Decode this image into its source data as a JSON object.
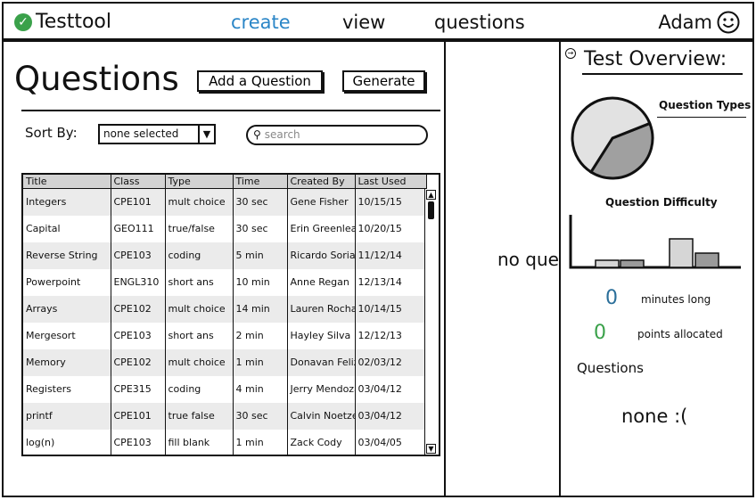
{
  "app": {
    "name": "Testtool"
  },
  "nav": {
    "create": "create",
    "view": "view",
    "questions": "questions"
  },
  "user": {
    "name": "Adam"
  },
  "colors": {
    "accent": "#2b86c7",
    "brand_green": "#3aa14a",
    "stat_green": "#3aa14a",
    "stat_blue": "#2b6f9a"
  },
  "questions_page": {
    "title": "Questions",
    "add_button": "Add a Question",
    "generate_button": "Generate",
    "sort_label": "Sort By:",
    "sort_value": "none selected",
    "search_placeholder": "search",
    "table": {
      "headers": [
        "Title",
        "Class",
        "Type",
        "Time",
        "Created By",
        "Last Used"
      ],
      "rows": [
        [
          "Integers",
          "CPE101",
          "mult choice",
          "30 sec",
          "Gene Fisher",
          "10/15/15"
        ],
        [
          "Capital",
          "GEO111",
          "true/false",
          "30 sec",
          "Erin Greenleaf",
          "10/20/15"
        ],
        [
          "Reverse String",
          "CPE103",
          "coding",
          "5 min",
          "Ricardo Soriano",
          "11/12/14"
        ],
        [
          "Powerpoint",
          "ENGL310",
          "short ans",
          "10 min",
          "Anne Regan",
          "12/13/14"
        ],
        [
          "Arrays",
          "CPE102",
          "mult choice",
          "14 min",
          "Lauren Rocha",
          "10/14/15"
        ],
        [
          "Mergesort",
          "CPE103",
          "short ans",
          "2 min",
          "Hayley Silva",
          "12/12/13"
        ],
        [
          "Memory",
          "CPE102",
          "mult choice",
          "1 min",
          "Donavan Feliz",
          "02/03/12"
        ],
        [
          "Registers",
          "CPE315",
          "coding",
          "4 min",
          "Jerry Mendoza",
          "03/04/12"
        ],
        [
          "printf",
          "CPE101",
          "true false",
          "30 sec",
          "Calvin Noetzel",
          "03/04/12"
        ],
        [
          "log(n)",
          "CPE103",
          "fill blank",
          "1 min",
          "Zack Cody",
          "03/04/05"
        ]
      ]
    }
  },
  "selected_panel": {
    "empty_message": "no questions"
  },
  "overview": {
    "title": "Test Overview:",
    "question_types_label": "Question Types",
    "question_difficulty_label": "Question Difficulty",
    "minutes_value": "0",
    "minutes_label": "minutes long",
    "points_value": "0",
    "points_label": "points allocated",
    "questions_label": "Questions",
    "questions_value": "none :("
  },
  "chart_data": [
    {
      "type": "pie",
      "title": "Question Types",
      "slices": [
        {
          "value": 0.4,
          "color": "#a0a0a0"
        },
        {
          "value": 0.6,
          "color": "#e2e2e2"
        }
      ]
    },
    {
      "type": "bar",
      "title": "Question Difficulty",
      "values": [
        1,
        1,
        0,
        0,
        4,
        2
      ]
    }
  ]
}
